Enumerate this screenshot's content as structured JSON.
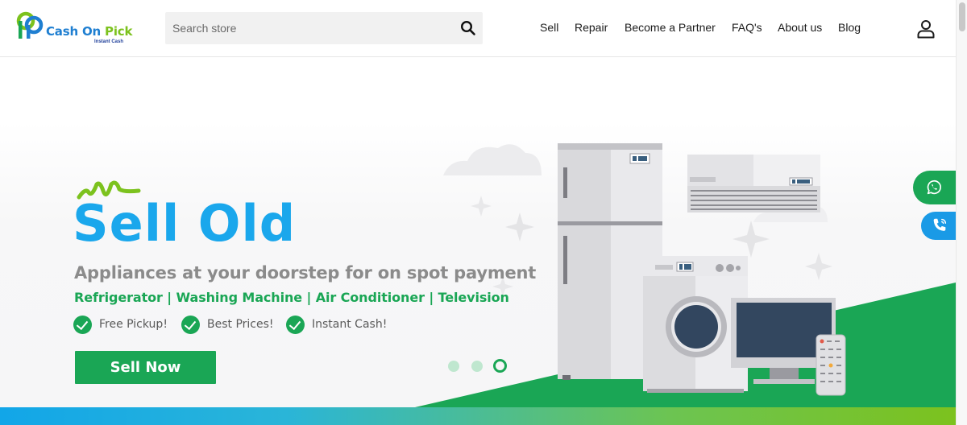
{
  "header": {
    "logo": {
      "brand_part1": "Cash On",
      "brand_part2": "Pick",
      "tagline": "Instant Cash"
    },
    "search": {
      "placeholder": "Search store",
      "icon": "search-icon"
    },
    "nav": [
      {
        "label": "Sell"
      },
      {
        "label": "Repair"
      },
      {
        "label": "Become a Partner"
      },
      {
        "label": "FAQ's"
      },
      {
        "label": "About us"
      },
      {
        "label": "Blog"
      }
    ],
    "user_icon": "user-icon"
  },
  "hero": {
    "title": "Sell Old",
    "subtitle": "Appliances at your doorstep for on spot payment",
    "categories": "Refrigerator | Washing Machine | Air Conditioner | Television",
    "features": [
      {
        "label": "Free Pickup!"
      },
      {
        "label": "Best Prices!"
      },
      {
        "label": "Instant Cash!"
      }
    ],
    "cta_label": "Sell Now",
    "carousel": {
      "slide_count": 3,
      "active_index": 2
    }
  },
  "floating": {
    "whatsapp_icon": "whatsapp-icon",
    "call_icon": "phone-icon"
  },
  "colors": {
    "brand_blue": "#1aa7ec",
    "brand_green": "#1aa655",
    "lime": "#7cc21e",
    "text_gray": "#8b8b8b"
  }
}
